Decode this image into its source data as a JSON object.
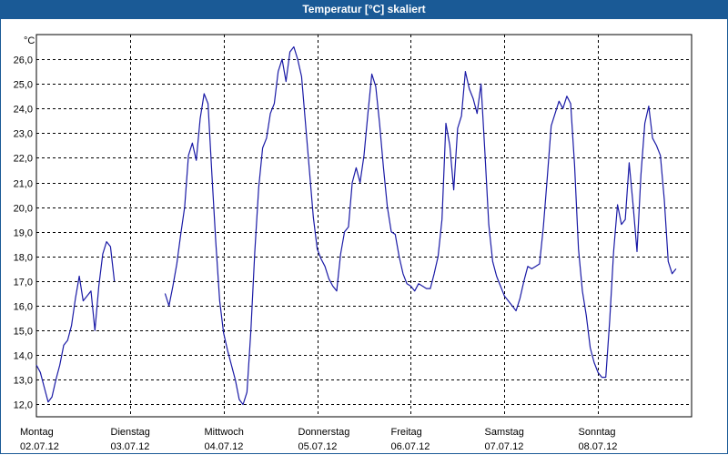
{
  "window": {
    "title": "Temperatur [°C] skaliert"
  },
  "colors": {
    "titlebar": "#1a5a96",
    "line": "#1a1aa6",
    "grid": "#000000"
  },
  "chart_data": {
    "type": "line",
    "title": "Temperatur [°C] skaliert",
    "ylabel": "°C",
    "ylim": [
      11.5,
      27.0
    ],
    "xlim": [
      0,
      168
    ],
    "grid": true,
    "y_ticks": [
      "12,0",
      "13,0",
      "14,0",
      "15,0",
      "16,0",
      "17,0",
      "18,0",
      "19,0",
      "20,0",
      "21,0",
      "22,0",
      "23,0",
      "24,0",
      "25,0",
      "26,0"
    ],
    "y_tick_values": [
      12,
      13,
      14,
      15,
      16,
      17,
      18,
      19,
      20,
      21,
      22,
      23,
      24,
      25,
      26
    ],
    "x_categories": [
      {
        "day": "Montag",
        "date": "02.07.12"
      },
      {
        "day": "Dienstag",
        "date": "03.07.12"
      },
      {
        "day": "Mittwoch",
        "date": "04.07.12"
      },
      {
        "day": "Donnerstag",
        "date": "05.07.12"
      },
      {
        "day": "Freitag",
        "date": "06.07.12"
      },
      {
        "day": "Samstag",
        "date": "07.07.12"
      },
      {
        "day": "Sonntag",
        "date": "08.07.12"
      }
    ],
    "series": [
      {
        "segments": [
          [
            [
              0,
              13.6
            ],
            [
              1,
              13.3
            ],
            [
              2,
              12.7
            ],
            [
              3,
              12.1
            ],
            [
              4,
              12.3
            ],
            [
              5,
              13.0
            ],
            [
              6,
              13.6
            ],
            [
              7,
              14.4
            ],
            [
              8,
              14.6
            ],
            [
              9,
              15.2
            ],
            [
              10,
              16.3
            ],
            [
              11,
              17.2
            ],
            [
              12,
              16.2
            ],
            [
              13,
              16.4
            ],
            [
              14,
              16.6
            ],
            [
              15,
              15.0
            ],
            [
              16,
              16.8
            ],
            [
              17,
              18.1
            ],
            [
              18,
              18.6
            ],
            [
              19,
              18.4
            ],
            [
              20,
              17.0
            ]
          ],
          [
            [
              33,
              16.5
            ],
            [
              34,
              16.0
            ],
            [
              35,
              16.8
            ],
            [
              36,
              17.7
            ],
            [
              37,
              18.9
            ],
            [
              38,
              20.0
            ],
            [
              39,
              22.1
            ],
            [
              40,
              22.6
            ],
            [
              41,
              21.9
            ],
            [
              42,
              23.6
            ],
            [
              43,
              24.6
            ],
            [
              44,
              24.2
            ],
            [
              45,
              21.3
            ],
            [
              46,
              18.6
            ],
            [
              47,
              16.2
            ],
            [
              48,
              14.9
            ],
            [
              49,
              14.2
            ],
            [
              50,
              13.6
            ],
            [
              51,
              13.0
            ],
            [
              52,
              12.2
            ],
            [
              53,
              12.0
            ],
            [
              54,
              12.5
            ],
            [
              55,
              15.0
            ],
            [
              56,
              18.2
            ],
            [
              57,
              20.8
            ],
            [
              58,
              22.4
            ],
            [
              59,
              22.8
            ],
            [
              60,
              23.8
            ],
            [
              61,
              24.2
            ],
            [
              62,
              25.5
            ],
            [
              63,
              26.0
            ],
            [
              64,
              25.1
            ],
            [
              65,
              26.3
            ],
            [
              66,
              26.5
            ],
            [
              67,
              26.0
            ],
            [
              68,
              25.3
            ],
            [
              69,
              23.4
            ],
            [
              70,
              21.5
            ],
            [
              71,
              19.6
            ],
            [
              72,
              18.3
            ],
            [
              73,
              17.9
            ],
            [
              74,
              17.6
            ],
            [
              75,
              17.1
            ],
            [
              76,
              16.8
            ],
            [
              77,
              16.6
            ],
            [
              78,
              18.1
            ],
            [
              79,
              19.0
            ],
            [
              80,
              19.2
            ],
            [
              81,
              21.0
            ],
            [
              82,
              21.6
            ],
            [
              83,
              21.0
            ],
            [
              84,
              22.1
            ],
            [
              85,
              23.8
            ],
            [
              86,
              25.4
            ],
            [
              87,
              24.9
            ],
            [
              88,
              23.4
            ],
            [
              89,
              21.6
            ],
            [
              90,
              20.0
            ],
            [
              91,
              19.0
            ],
            [
              92,
              18.9
            ],
            [
              93,
              18.0
            ],
            [
              94,
              17.3
            ],
            [
              95,
              16.9
            ],
            [
              96,
              16.8
            ],
            [
              97,
              16.6
            ],
            [
              98,
              16.9
            ],
            [
              99,
              16.8
            ],
            [
              100,
              16.7
            ],
            [
              101,
              16.7
            ],
            [
              102,
              17.3
            ],
            [
              103,
              18.0
            ],
            [
              104,
              19.5
            ],
            [
              105,
              23.4
            ],
            [
              106,
              22.5
            ],
            [
              107,
              20.7
            ],
            [
              108,
              23.2
            ],
            [
              109,
              23.7
            ],
            [
              110,
              25.5
            ],
            [
              111,
              24.8
            ],
            [
              112,
              24.4
            ],
            [
              113,
              23.8
            ],
            [
              114,
              25.0
            ],
            [
              115,
              22.2
            ],
            [
              116,
              19.3
            ],
            [
              117,
              17.8
            ],
            [
              118,
              17.2
            ],
            [
              119,
              16.8
            ],
            [
              120,
              16.4
            ],
            [
              121,
              16.2
            ],
            [
              122,
              16.0
            ],
            [
              123,
              15.8
            ],
            [
              124,
              16.3
            ],
            [
              125,
              17.0
            ],
            [
              126,
              17.6
            ],
            [
              127,
              17.5
            ],
            [
              128,
              17.6
            ],
            [
              129,
              17.7
            ],
            [
              130,
              19.2
            ],
            [
              131,
              21.2
            ],
            [
              132,
              23.3
            ],
            [
              133,
              23.8
            ],
            [
              134,
              24.3
            ],
            [
              135,
              24.0
            ],
            [
              136,
              24.5
            ],
            [
              137,
              24.2
            ],
            [
              138,
              21.7
            ],
            [
              139,
              18.3
            ],
            [
              140,
              16.6
            ],
            [
              141,
              15.6
            ],
            [
              142,
              14.3
            ],
            [
              143,
              13.7
            ],
            [
              144,
              13.3
            ],
            [
              145,
              13.1
            ],
            [
              146,
              13.1
            ],
            [
              147,
              15.4
            ],
            [
              148,
              18.2
            ],
            [
              149,
              20.1
            ],
            [
              150,
              19.3
            ],
            [
              151,
              19.5
            ],
            [
              152,
              21.8
            ],
            [
              153,
              20.1
            ],
            [
              154,
              18.2
            ],
            [
              155,
              21.3
            ],
            [
              156,
              23.4
            ],
            [
              157,
              24.1
            ],
            [
              158,
              22.8
            ],
            [
              159,
              22.5
            ],
            [
              160,
              22.1
            ],
            [
              161,
              20.3
            ],
            [
              162,
              17.8
            ],
            [
              163,
              17.3
            ],
            [
              164,
              17.5
            ]
          ]
        ]
      }
    ]
  }
}
